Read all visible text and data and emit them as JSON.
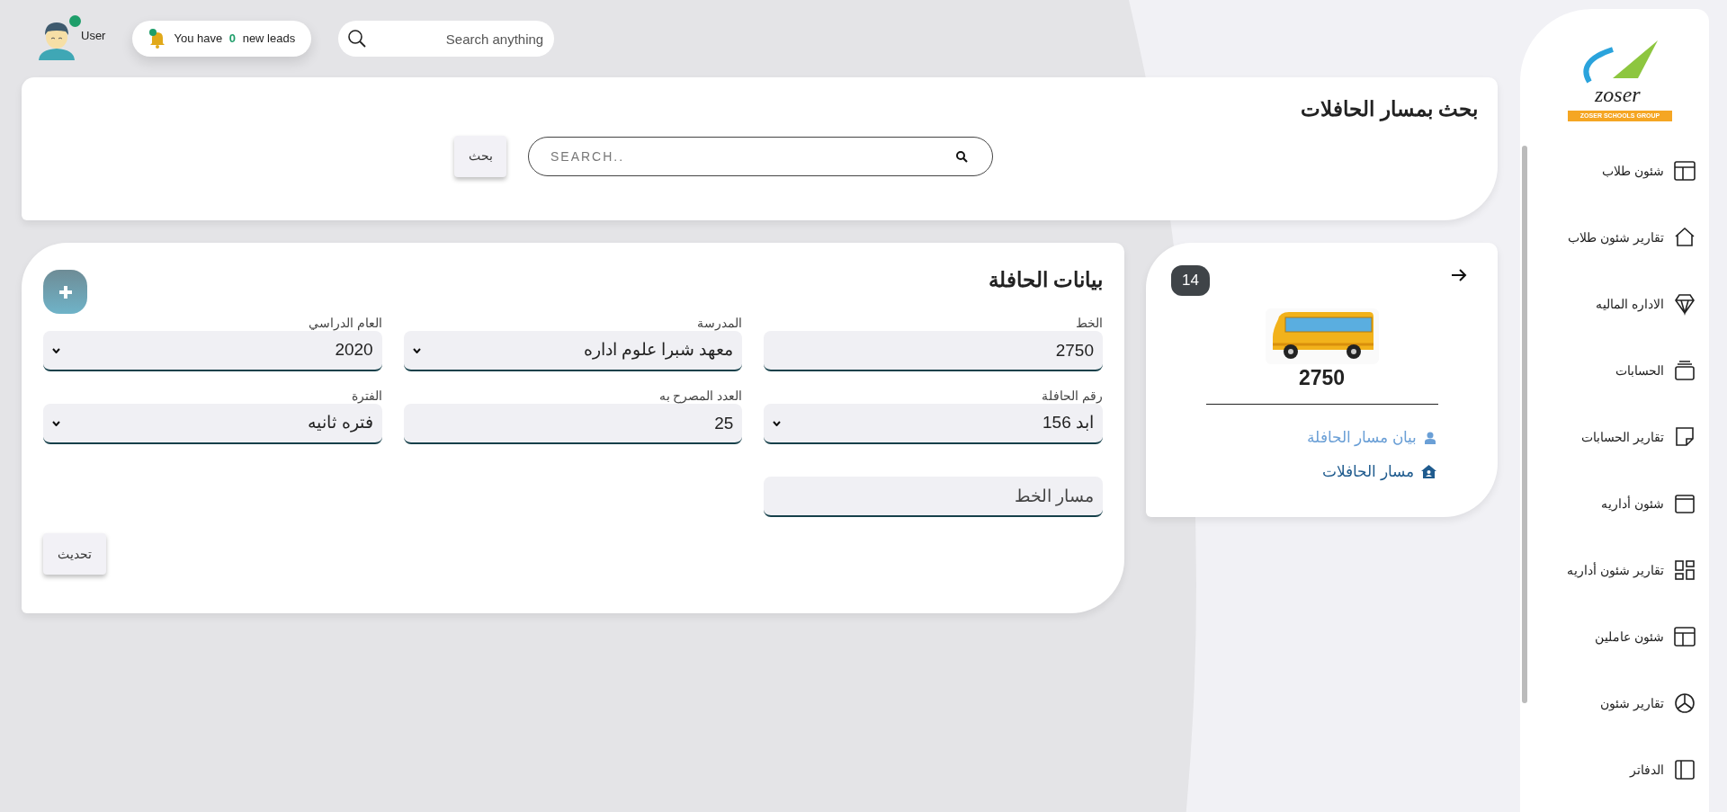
{
  "header": {
    "user": {
      "label": "User"
    },
    "leads": {
      "prefix": "You have",
      "count": "0",
      "suffix": "new leads"
    },
    "search": {
      "placeholder": "Search anything"
    }
  },
  "search_card": {
    "title": "بحث بمسار الحافلات",
    "search": {
      "placeholder": "SEARCH.."
    },
    "button": "بحث"
  },
  "bus_form": {
    "title": "بيانات الحافلة",
    "fields": [
      {
        "label": "الخط",
        "kind": "input",
        "value": "2750"
      },
      {
        "label": "المدرسة",
        "kind": "select",
        "value": "معهد شبرا علوم اداره"
      },
      {
        "label": "العام الدراسي",
        "kind": "select",
        "value": "2020"
      },
      {
        "label": "رقم الحافلة",
        "kind": "select",
        "value": "ابد 156"
      },
      {
        "label": "العدد المصرح به",
        "kind": "input",
        "value": "25"
      },
      {
        "label": "الفترة",
        "kind": "select",
        "value": "فتره ثانيه"
      },
      {
        "kind": "input",
        "placeholder": "مسار الخط"
      }
    ],
    "button": "تحديث"
  },
  "bus_card": {
    "badge": "14",
    "number": "2750",
    "links": [
      {
        "label": "بيان مسار الحافلة",
        "color": "#6a9fd6"
      },
      {
        "label": "مسار الحافلات",
        "color": "#1f5b8e"
      }
    ]
  },
  "sidebar": {
    "logo": {
      "text": "zoser",
      "subtitle": "ZOSER SCHOOLS GROUP"
    },
    "items": [
      {
        "label": "شئون طلاب"
      },
      {
        "label": "تقارير شئون طلاب"
      },
      {
        "label": "الاداره الماليه"
      },
      {
        "label": "الحسابات"
      },
      {
        "label": "تقارير الحسابات"
      },
      {
        "label": "شئون أداريه"
      },
      {
        "label": "تقارير شئون أداريه"
      },
      {
        "label": "شئون عاملين"
      },
      {
        "label": "تقارير شئون"
      },
      {
        "label": "الدفاتر"
      }
    ]
  }
}
